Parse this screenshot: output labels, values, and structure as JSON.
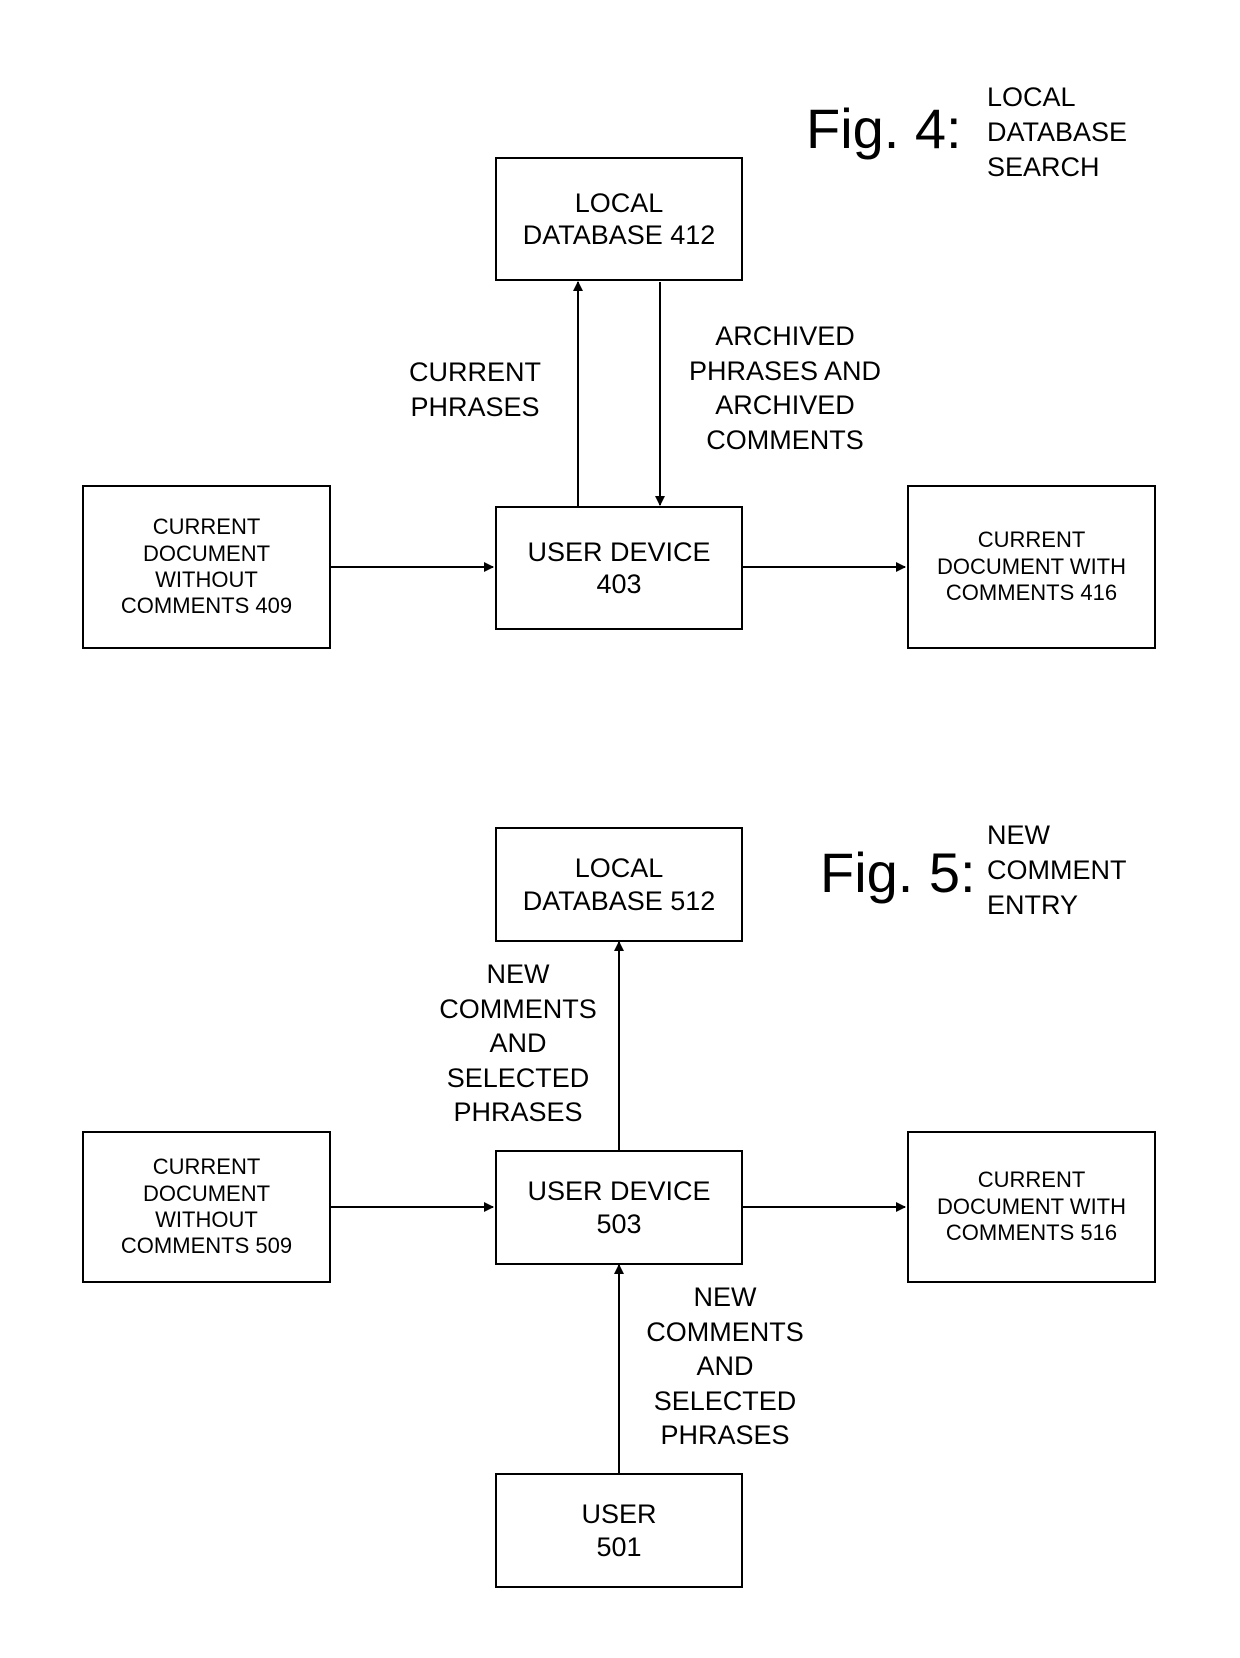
{
  "fig4": {
    "title": "Fig. 4:",
    "subtitle": "LOCAL\nDATABASE\nSEARCH",
    "nodes": {
      "local_database": "LOCAL\nDATABASE 412",
      "user_device": "USER DEVICE\n403",
      "doc_without": "CURRENT\nDOCUMENT\nWITHOUT\nCOMMENTS 409",
      "doc_with": "CURRENT\nDOCUMENT WITH\nCOMMENTS 416"
    },
    "edges": {
      "up_label": "CURRENT\nPHRASES",
      "down_label": "ARCHIVED\nPHRASES AND\nARCHIVED\nCOMMENTS"
    }
  },
  "fig5": {
    "title": "Fig. 5:",
    "subtitle": "NEW\nCOMMENT\nENTRY",
    "nodes": {
      "local_database": "LOCAL\nDATABASE 512",
      "user_device": "USER DEVICE\n503",
      "doc_without": "CURRENT\nDOCUMENT\nWITHOUT\nCOMMENTS 509",
      "doc_with": "CURRENT\nDOCUMENT WITH\nCOMMENTS 516",
      "user": "USER\n501"
    },
    "edges": {
      "device_to_db_label": "NEW\nCOMMENTS\nAND\nSELECTED\nPHRASES",
      "user_to_device_label": "NEW\nCOMMENTS\nAND\nSELECTED\nPHRASES"
    }
  }
}
